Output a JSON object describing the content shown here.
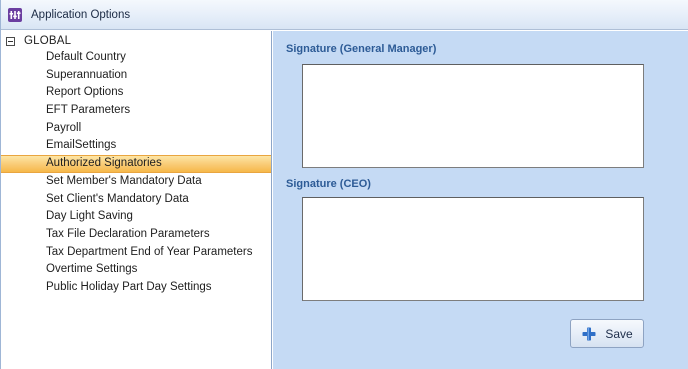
{
  "window": {
    "title": "Application Options",
    "icon": "app-options-icon"
  },
  "tree": {
    "root_label": "GLOBAL",
    "expander_icon": "collapse-minus-icon",
    "items": [
      "Default Country",
      "Superannuation",
      "Report Options",
      "EFT Parameters",
      "Payroll",
      "EmailSettings",
      "Authorized Signatories",
      "Set Member's Mandatory Data",
      "Set Client's Mandatory Data",
      "Day Light Saving",
      "Tax File Declaration Parameters",
      "Tax Department End of Year Parameters",
      "Overtime Settings",
      "Public Holiday Part Day Settings"
    ],
    "selected": "Authorized Signatories"
  },
  "content": {
    "sig_gm_label": "Signature (General Manager)",
    "sig_ceo_label": "Signature (CEO)",
    "save_label": "Save",
    "save_icon": "plus-icon"
  },
  "colors": {
    "selection": "#f9cc78",
    "content_background": "#c5daf4",
    "label_blue": "#2d5b96",
    "titlebar": "#e6eef9"
  }
}
